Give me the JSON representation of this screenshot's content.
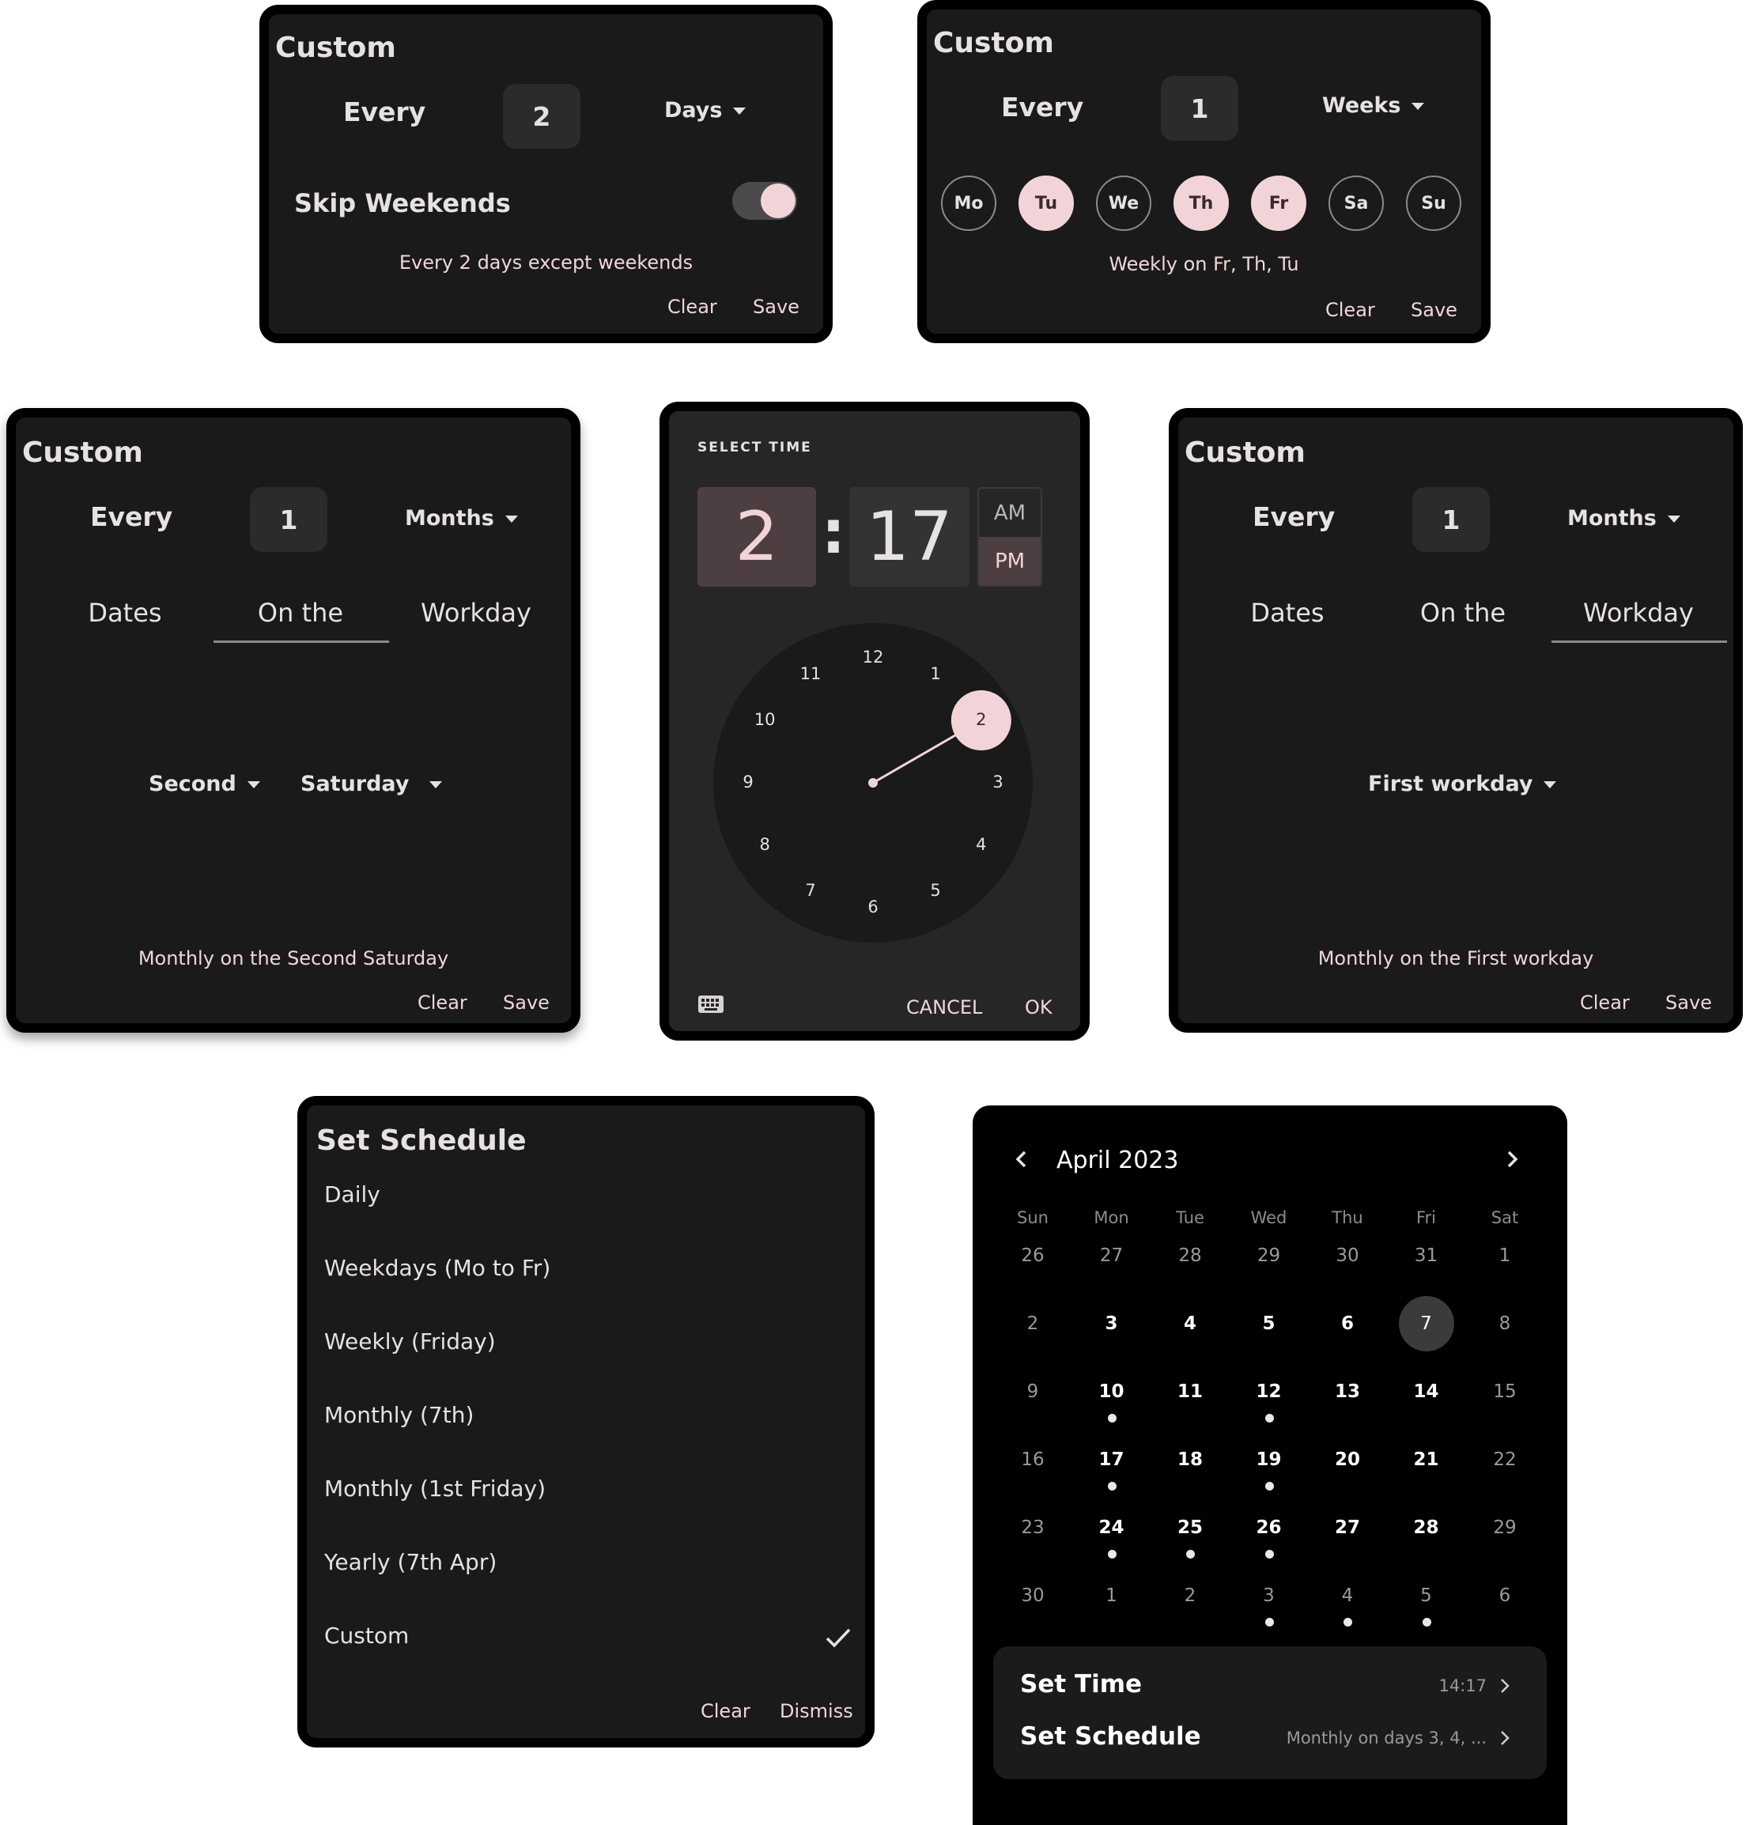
{
  "days_panel": {
    "title": "Custom",
    "every_label": "Every",
    "interval": "2",
    "unit": "Days",
    "skip_weekends_label": "Skip Weekends",
    "skip_weekends_on": true,
    "summary": "Every 2 days except weekends",
    "clear": "Clear",
    "save": "Save"
  },
  "weeks_panel": {
    "title": "Custom",
    "every_label": "Every",
    "interval": "1",
    "unit": "Weeks",
    "days": [
      {
        "label": "Mo",
        "selected": false
      },
      {
        "label": "Tu",
        "selected": true
      },
      {
        "label": "We",
        "selected": false
      },
      {
        "label": "Th",
        "selected": true
      },
      {
        "label": "Fr",
        "selected": true
      },
      {
        "label": "Sa",
        "selected": false
      },
      {
        "label": "Su",
        "selected": false
      }
    ],
    "summary": "Weekly on Fr, Th, Tu",
    "clear": "Clear",
    "save": "Save"
  },
  "months_onthe_panel": {
    "title": "Custom",
    "every_label": "Every",
    "interval": "1",
    "unit": "Months",
    "tabs": [
      "Dates",
      "On the",
      "Workday"
    ],
    "active_tab": "On the",
    "ordinal": "Second",
    "weekday": "Saturday",
    "summary": "Monthly on the Second Saturday",
    "clear": "Clear",
    "save": "Save"
  },
  "time_picker": {
    "header": "SELECT TIME",
    "hour": "2",
    "separator": ":",
    "minute": "17",
    "am": "AM",
    "pm": "PM",
    "period_selected": "PM",
    "clock_numbers": [
      "12",
      "1",
      "2",
      "3",
      "4",
      "5",
      "6",
      "7",
      "8",
      "9",
      "10",
      "11"
    ],
    "selected_hour": "2",
    "cancel": "CANCEL",
    "ok": "OK",
    "keyboard_icon": "keyboard-icon"
  },
  "months_workday_panel": {
    "title": "Custom",
    "every_label": "Every",
    "interval": "1",
    "unit": "Months",
    "tabs": [
      "Dates",
      "On the",
      "Workday"
    ],
    "active_tab": "Workday",
    "workday": "First workday",
    "summary": "Monthly on the First workday",
    "clear": "Clear",
    "save": "Save"
  },
  "schedule_panel": {
    "title": "Set Schedule",
    "items": [
      "Daily",
      "Weekdays (Mo to Fr)",
      "Weekly (Friday)",
      "Monthly (7th)",
      "Monthly (1st Friday)",
      "Yearly (7th Apr)",
      "Custom"
    ],
    "selected": "Custom",
    "clear": "Clear",
    "dismiss": "Dismiss"
  },
  "calendar": {
    "month_label": "April 2023",
    "weekdays": [
      "Sun",
      "Mon",
      "Tue",
      "Wed",
      "Thu",
      "Fri",
      "Sat"
    ],
    "weeks": [
      [
        {
          "d": "26",
          "t": "out"
        },
        {
          "d": "27",
          "t": "out"
        },
        {
          "d": "28",
          "t": "out"
        },
        {
          "d": "29",
          "t": "out"
        },
        {
          "d": "30",
          "t": "out"
        },
        {
          "d": "31",
          "t": "out"
        },
        {
          "d": "1",
          "t": "wk"
        }
      ],
      [
        {
          "d": "2",
          "t": "wk"
        },
        {
          "d": "3",
          "t": "in"
        },
        {
          "d": "4",
          "t": "in"
        },
        {
          "d": "5",
          "t": "in"
        },
        {
          "d": "6",
          "t": "in"
        },
        {
          "d": "7",
          "t": "today"
        },
        {
          "d": "8",
          "t": "wk"
        }
      ],
      [
        {
          "d": "9",
          "t": "wk"
        },
        {
          "d": "10",
          "t": "in",
          "dot": true
        },
        {
          "d": "11",
          "t": "in"
        },
        {
          "d": "12",
          "t": "in",
          "dot": true
        },
        {
          "d": "13",
          "t": "in"
        },
        {
          "d": "14",
          "t": "in"
        },
        {
          "d": "15",
          "t": "wk"
        }
      ],
      [
        {
          "d": "16",
          "t": "wk"
        },
        {
          "d": "17",
          "t": "in",
          "dot": true
        },
        {
          "d": "18",
          "t": "in"
        },
        {
          "d": "19",
          "t": "in",
          "dot": true
        },
        {
          "d": "20",
          "t": "in"
        },
        {
          "d": "21",
          "t": "in"
        },
        {
          "d": "22",
          "t": "wk"
        }
      ],
      [
        {
          "d": "23",
          "t": "wk"
        },
        {
          "d": "24",
          "t": "in",
          "dot": true
        },
        {
          "d": "25",
          "t": "in",
          "dot": true
        },
        {
          "d": "26",
          "t": "in",
          "dot": true
        },
        {
          "d": "27",
          "t": "in"
        },
        {
          "d": "28",
          "t": "in"
        },
        {
          "d": "29",
          "t": "wk"
        }
      ],
      [
        {
          "d": "30",
          "t": "wk"
        },
        {
          "d": "1",
          "t": "out"
        },
        {
          "d": "2",
          "t": "out"
        },
        {
          "d": "3",
          "t": "out",
          "dot": true
        },
        {
          "d": "4",
          "t": "out",
          "dot": true
        },
        {
          "d": "5",
          "t": "out",
          "dot": true
        },
        {
          "d": "6",
          "t": "out"
        }
      ]
    ],
    "set_time_label": "Set Time",
    "set_time_value": "14:17",
    "set_schedule_label": "Set Schedule",
    "set_schedule_value": "Monthly on days 3, 4, ..."
  },
  "colors": {
    "panel_bg": "#1a1a1a",
    "accent_pink": "#f2d4d8",
    "calendar_bg": "#000000"
  }
}
